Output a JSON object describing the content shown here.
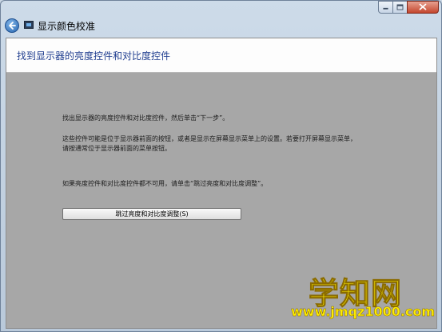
{
  "window": {
    "title": "显示颜色校准"
  },
  "header": {
    "heading": "找到显示器的亮度控件和对比度控件"
  },
  "body": {
    "line1": "找出显示器的亮度控件和对比度控件，然后单击“下一步”。",
    "line2": "这些控件可能是位于显示器前面的按钮，或者是显示在屏幕显示菜单上的设置。若要打开屏幕显示菜单，",
    "line3": "请按通常位于显示器前面的菜单按钮。",
    "line4": "如果亮度控件和对比度控件都不可用，请单击“跳过亮度和对比度调整”。",
    "skip_button": "跳过亮度和对比度调整(S)"
  },
  "watermark": {
    "cn": "学知网",
    "url": "www.jmqz1000.com"
  },
  "icons": {
    "back": "back-arrow-icon",
    "app": "display-icon",
    "minimize": "minimize-icon",
    "maximize": "maximize-icon",
    "close": "close-icon"
  },
  "colors": {
    "heading": "#1f3d8f",
    "content_bg": "#a7a7a7",
    "close_button": "#c4462d",
    "watermark": "#ffee00"
  }
}
